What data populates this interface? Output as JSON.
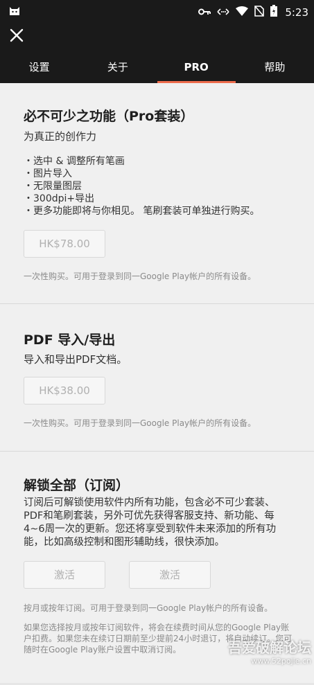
{
  "status_bar": {
    "time": "5:23",
    "icons": [
      "android-cat-icon",
      "key-icon",
      "data-arrows-icon",
      "wifi-icon",
      "no-sim-icon",
      "battery-icon"
    ]
  },
  "tabs": [
    {
      "label": "设置",
      "active": false
    },
    {
      "label": "关于",
      "active": false
    },
    {
      "label": "PRO",
      "active": true
    },
    {
      "label": "帮助",
      "active": false
    }
  ],
  "sections": {
    "essentials": {
      "title": "必不可少之功能（Pro套装）",
      "subtitle": "为真正的创作力",
      "features": [
        "・选中 & 调整所有笔画",
        "・图片导入",
        "・无限量图层",
        "・300dpi+导出",
        "・更多功能即将与你相见。 笔刷套装可单独进行购买。"
      ],
      "price": "HK$78.00",
      "note": "一次性购买。可用于登录到同一Google Play帐户的所有设备。"
    },
    "pdf": {
      "title": "PDF 导入/导出",
      "subtitle": "导入和导出PDF文档。",
      "price": "HK$38.00",
      "note": "一次性购买。可用于登录到同一Google Play帐户的所有设备。"
    },
    "unlock_all": {
      "title": "解锁全部（订阅）",
      "description": "订阅后可解锁使用软件内所有功能，包含必不可少套装、PDF和笔刷套装，另外可优先获得客服支持、新功能、每4~6周一次的更新。您还将享受到软件未来添加的所有功能，比如高级控制和图形辅助线，很快添加。",
      "button_1": "激活",
      "button_2": "激活",
      "note": "按月或按年订阅。可用于登录到同一Google Play帐户的所有设备。",
      "terms": "如果您选择按月或按年订阅软件，将会在续费时间从您的Google Play账户扣费。如果您未在续订日期前至少提前24小时退订，将自动续订。您可随时在Google Play账户设置中取消订阅。"
    }
  },
  "watermark": {
    "text": "吾爱破解论坛",
    "url": "www.52pojie.cn"
  },
  "colors": {
    "bar_background": "#1a1a1a",
    "tab_indicator": "#ee6d4c",
    "page_background": "#f0f0f0"
  }
}
